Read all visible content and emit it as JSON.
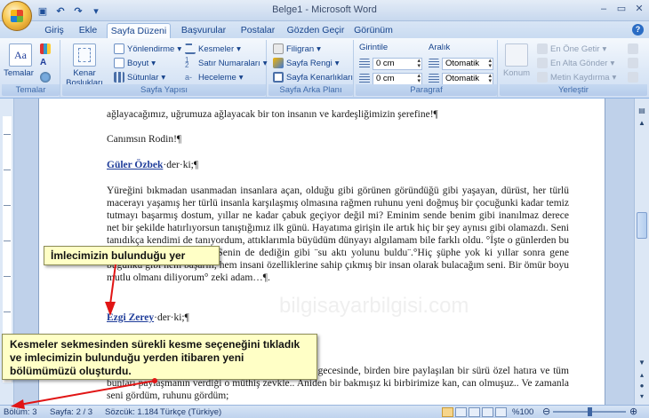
{
  "window": {
    "title": "Belge1 - Microsoft Word",
    "minimize": "–",
    "restore": "▭",
    "close": "✕"
  },
  "tabs": [
    {
      "label": "Giriş",
      "active": false
    },
    {
      "label": "Ekle",
      "active": false
    },
    {
      "label": "Sayfa Düzeni",
      "active": true
    },
    {
      "label": "Başvurular",
      "active": false
    },
    {
      "label": "Postalar",
      "active": false
    },
    {
      "label": "Gözden Geçir",
      "active": false
    },
    {
      "label": "Görünüm",
      "active": false
    }
  ],
  "ribbon": {
    "temalar": {
      "group_label": "Temalar",
      "button_label": "Temalar"
    },
    "sayfa_yapisi": {
      "group_label": "Sayfa Yapısı",
      "kenar_line1": "Kenar",
      "kenar_line2": "Boşlukları",
      "yonlendirme": "Yönlendirme",
      "boyut": "Boyut",
      "sutunlar": "Sütunlar",
      "kesmeler": "Kesmeler",
      "satir_numaralari": "Satır Numaraları",
      "heceleme": "Heceleme"
    },
    "sayfa_arka_plani": {
      "group_label": "Sayfa Arka Planı",
      "filigran": "Filigran",
      "sayfa_rengi": "Sayfa Rengi",
      "sayfa_kenarliklari": "Sayfa Kenarlıkları"
    },
    "paragraf": {
      "group_label": "Paragraf",
      "girinti": "Girintile",
      "aralik": "Aralık",
      "girinti_sol": "0 cm",
      "girinti_sag": "0 cm",
      "aralik_once": "Otomatik",
      "aralik_sonra": "Otomatik"
    },
    "yerlestir": {
      "group_label": "Yerleştir",
      "konum": "Konum",
      "en_one_getir": "En Öne Getir",
      "en_alta_gonder": "En Alta Gönder",
      "metin_kaydirma": "Metin Kaydırma"
    }
  },
  "document": {
    "lines_p1": "ağlayacağımız, uğrumuza ağlayacak bir ton insanın ve kardeşliğimizin şerefine!¶",
    "line_canimsin": "Canımsın Rodin!¶",
    "name1": "Güler Özbek",
    "name1_suffix": "·der·ki;¶",
    "body_paragraph": "Yüreğini bıkmadan usanmadan insanlara açan, olduğu gibi görünen göründüğü gibi yaşayan, dürüst, her türlü macerayı yaşamış her türlü insanla karşılaşmış olmasına rağmen ruhunu yeni doğmuş bir çocuğunki kadar temiz tutmayı başarmış dostum, yıllar ne kadar çabuk geçiyor değil mi? Eminim sende benim gibi inanılmaz derece net bir şekilde hatırlıyorsun tanıştığımız ilk günü. Hayatıma girişin ile artık hiç bir şey aynısı gibi olamazdı. Seni tanıdıkça kendimi de tanıyordum, attıklarımla büyüdüm dünyayı algılamam bile farklı oldu. °İşte o günlerden bu günlere çok şey yaşandı. Senin de dediğin gibi ¨su aktı yolunu buldu¨.°Hiç şüphe yok ki yıllar sonra gene bugünkü gibi hem başarılı, hem insani özelliklerine sahip çıkmış bir insan olarak bulacağım seni. Bir ömür boyu mutlu olmanı diliyorum° zeki adam…¶.",
    "name2": "Ezgi Zerey",
    "name2_suffix": "·der·ki;¶",
    "bottom_paragraph": "gisi olmayan bir veda gecesinde, birden bire paylaşılan bir sürü özel hatıra ve tüm bunları paylaşmanın verdiği o müthiş zevkle.. Aniden bir bakmışız ki birbirimize kan, can olmuşuz.. Ve zamanla seni gördüm, ruhunu gördüm;",
    "watermark": "bilgisayarbilgisi.com"
  },
  "callouts": {
    "cursor_note": "İmlecimizin bulunduğu yer",
    "instruction": "Kesmeler sekmesinden sürekli kesme seçeneğini tıkladık ve imlecimizin bulunduğu yerden itibaren yeni bölümümüzü oluşturdu."
  },
  "statusbar": {
    "bolum": "Bölüm: 3",
    "sayfa": "Sayfa: 2 / 3",
    "sozcuk": "Sözcük: 1.184",
    "dil": "Türkçe (Türkiye)",
    "zoom": "%100"
  },
  "colors": {
    "callout_bg": "#ffffc6",
    "arrow_red": "#e11515",
    "name_link": "#1f3d9a"
  }
}
